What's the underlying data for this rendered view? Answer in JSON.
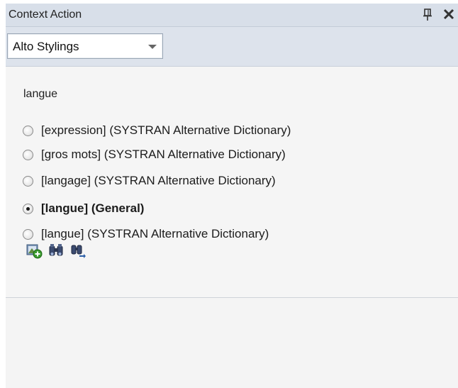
{
  "window": {
    "title": "Context Action",
    "pin_icon": "pin-icon",
    "close_icon": "close-icon"
  },
  "toolbar": {
    "dropdown_value": "Alto Stylings"
  },
  "main": {
    "heading": "langue",
    "options": [
      {
        "label": "[expression] (SYSTRAN Alternative Dictionary)",
        "selected": false
      },
      {
        "label": "[gros mots] (SYSTRAN Alternative Dictionary)",
        "selected": false
      },
      {
        "label": "[langage] (SYSTRAN Alternative Dictionary)",
        "selected": false
      },
      {
        "label": "[langue] (General)",
        "selected": true
      },
      {
        "label": "[langue] (SYSTRAN Alternative Dictionary)",
        "selected": false
      }
    ],
    "tools": [
      {
        "icon": "add-dictionary-icon"
      },
      {
        "icon": "binoculars-search-icon"
      },
      {
        "icon": "find-next-icon"
      }
    ]
  },
  "colors": {
    "titlebar": "#d8dfe9",
    "toolbar": "#dde3ec",
    "content": "#f5f5f5"
  }
}
